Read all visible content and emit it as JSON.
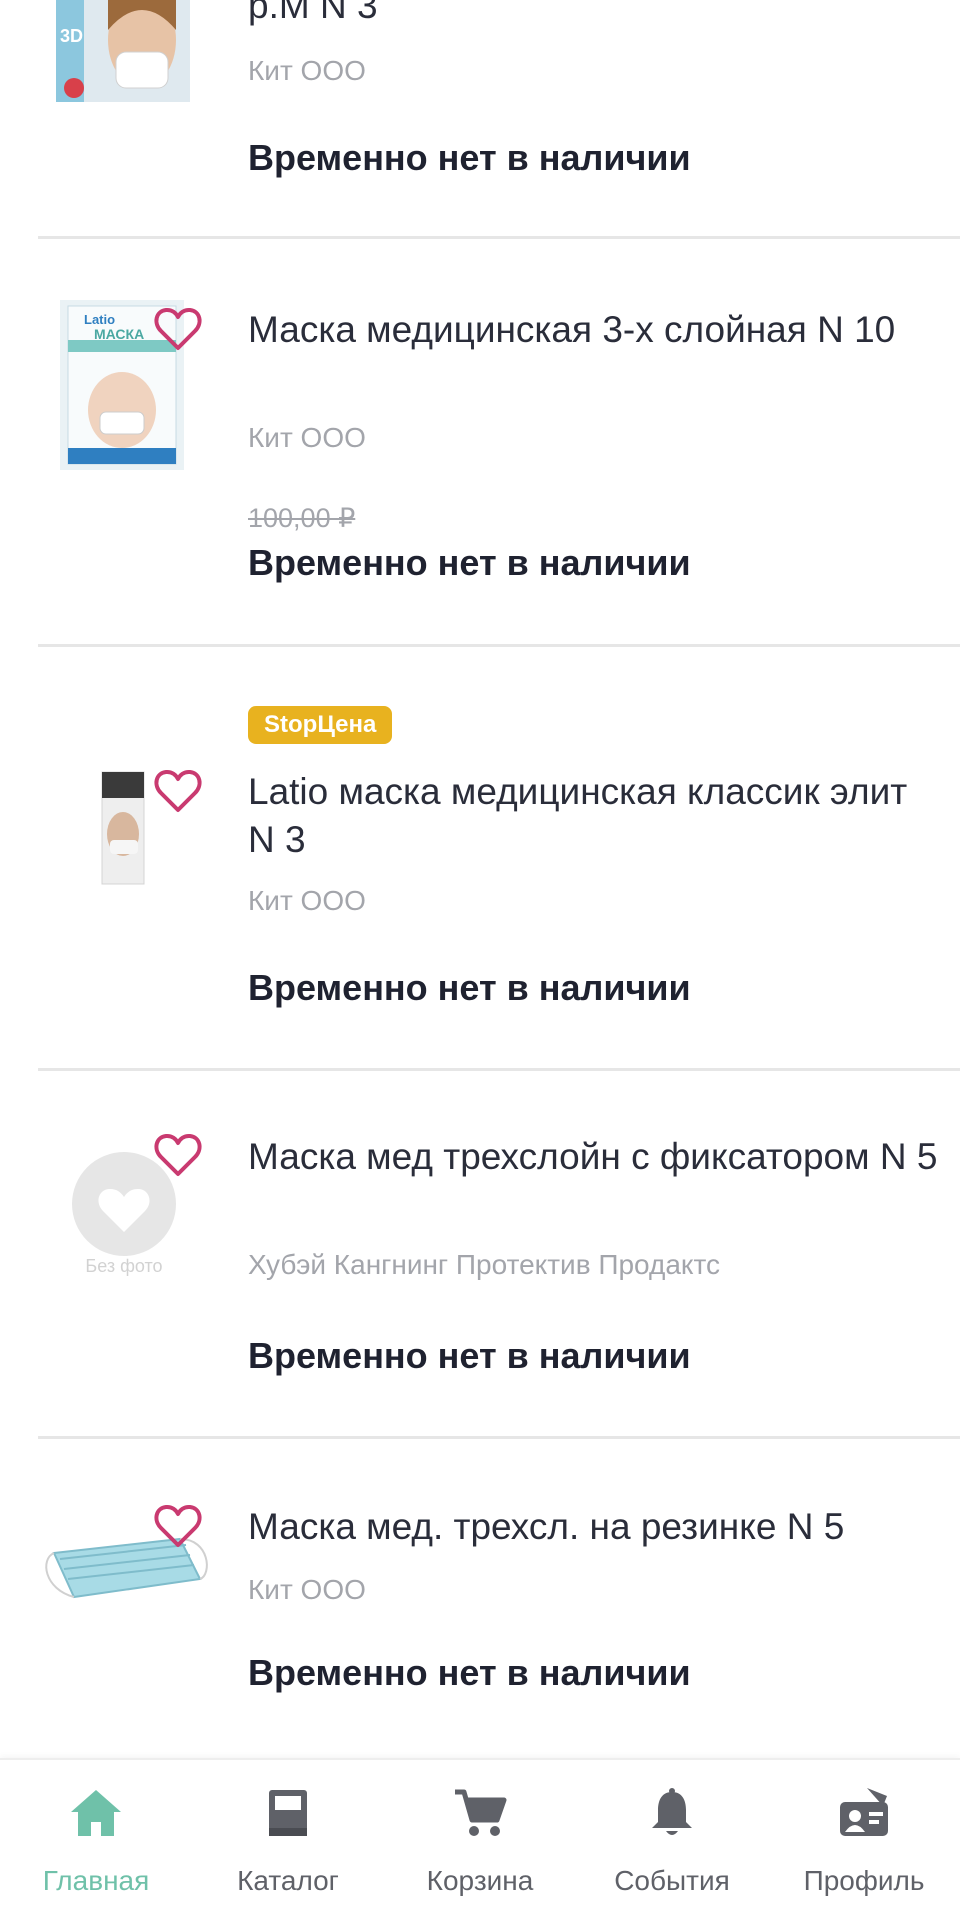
{
  "products": [
    {
      "title": "р.M N 3",
      "maker": "Кит ООО",
      "status": "Временно нет в наличии",
      "thumb_text": "3D"
    },
    {
      "title": "Маска медицинская 3-х слойная N 10",
      "maker": "Кит ООО",
      "old_price": "100,00 ₽",
      "status": "Временно нет в наличии",
      "thumb_text": "МАСКА",
      "thumb_brand": "Latio"
    },
    {
      "badge": "StopЦена",
      "title": "Latio маска медицинская классик элит N 3",
      "maker": "Кит ООО",
      "status": "Временно нет в наличии"
    },
    {
      "title": "Маска мед трехслойн с фиксатором N 5",
      "maker": "Хубэй Кангнинг Протектив Продактс",
      "status": "Временно нет в наличии",
      "no_photo": "Без фото"
    },
    {
      "title": "Маска мед. трехсл. на резинке N 5",
      "maker": "Кит ООО",
      "status": "Временно нет в наличии"
    }
  ],
  "nav": {
    "items": [
      {
        "label": "Главная",
        "icon": "home-icon",
        "active": true
      },
      {
        "label": "Каталог",
        "icon": "catalog-book-icon",
        "active": false
      },
      {
        "label": "Корзина",
        "icon": "cart-icon",
        "active": false
      },
      {
        "label": "События",
        "icon": "bell-icon",
        "active": false
      },
      {
        "label": "Профиль",
        "icon": "profile-card-icon",
        "active": false
      }
    ],
    "active_color": "#6fc1a9",
    "inactive_color": "#5f6168"
  },
  "colors": {
    "heart": "#c93a70",
    "badge": "#e8b21f",
    "divider": "#e6e6e6"
  }
}
